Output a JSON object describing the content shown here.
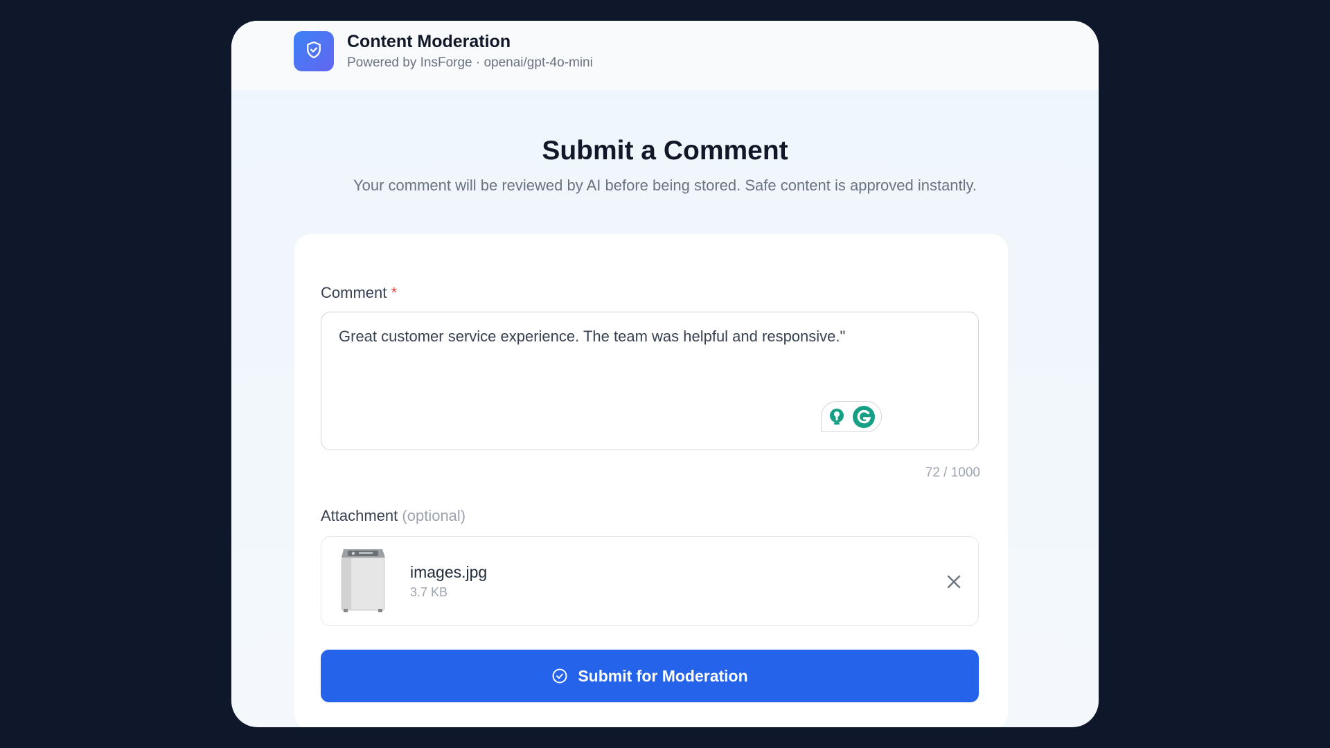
{
  "header": {
    "icon": "shield-check-icon",
    "title": "Content Moderation",
    "subtitle": "Powered by InsForge · openai/gpt-4o-mini"
  },
  "page": {
    "title": "Submit a Comment",
    "description": "Your comment will be reviewed by AI before being stored. Safe content is approved instantly."
  },
  "form": {
    "comment_label": "Comment",
    "required_marker": "*",
    "comment_value": "Great customer service experience. The team was helpful and responsive.\"",
    "char_count": "72 / 1000",
    "attachment_label": "Attachment",
    "attachment_optional": "(optional)",
    "attachment": {
      "file_name": "images.jpg",
      "file_size": "3.7 KB",
      "thumbnail": "washing-machine-thumbnail",
      "remove_icon": "close-icon"
    },
    "submit_label": "Submit for Moderation",
    "submit_icon": "check-circle-icon"
  },
  "extension": {
    "icons": [
      "lightbulb-icon",
      "grammarly-icon"
    ]
  },
  "colors": {
    "background": "#0f172a",
    "accent": "#2563eb",
    "required": "#ef4444",
    "grammarly": "#15a085"
  }
}
